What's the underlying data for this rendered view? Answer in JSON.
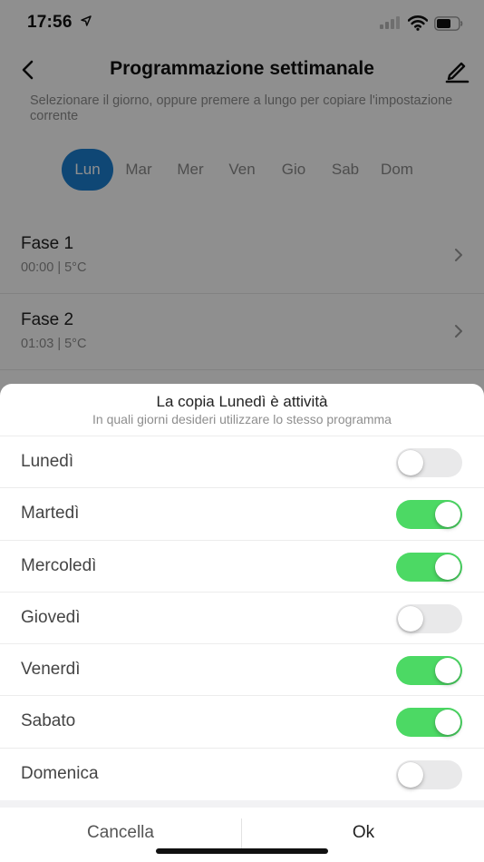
{
  "status_bar": {
    "time": "17:56",
    "icons": [
      "location-arrow-icon",
      "signal-icon",
      "wifi-icon",
      "battery-icon"
    ]
  },
  "nav": {
    "title": "Programmazione settimanale",
    "back_icon": "chevron-left-icon",
    "edit_icon": "pencil-icon"
  },
  "hint": "Selezionare il giorno, oppure premere a lungo per copiare l'impostazione corrente",
  "days": [
    {
      "label": "Lun",
      "selected": true
    },
    {
      "label": "Mar",
      "selected": false
    },
    {
      "label": "Mer",
      "selected": false
    },
    {
      "label": "Ven",
      "selected": false
    },
    {
      "label": "Gio",
      "selected": false
    },
    {
      "label": "Sab",
      "selected": false
    },
    {
      "label": "Dom",
      "selected": false
    }
  ],
  "phases": [
    {
      "name": "Fase 1",
      "detail": "00:00 | 5°C"
    },
    {
      "name": "Fase 2",
      "detail": "01:03 | 5°C"
    }
  ],
  "sheet": {
    "title": "La copia Lunedì  è attività",
    "subtitle": "In quali giorni desideri utilizzare lo stesso programma",
    "options": [
      {
        "label": "Lunedì",
        "enabled": false
      },
      {
        "label": "Martedì",
        "enabled": true
      },
      {
        "label": "Mercoledì",
        "enabled": true
      },
      {
        "label": "Giovedì",
        "enabled": false
      },
      {
        "label": "Venerdì",
        "enabled": true
      },
      {
        "label": "Sabato",
        "enabled": true
      },
      {
        "label": "Domenica",
        "enabled": false
      }
    ],
    "cancel_label": "Cancella",
    "ok_label": "Ok"
  },
  "colors": {
    "accent": "#1b7fd1",
    "toggle_on": "#4cd964",
    "toggle_off": "#e9e9ea",
    "overlay": "rgba(0,0,0,0.44)"
  }
}
